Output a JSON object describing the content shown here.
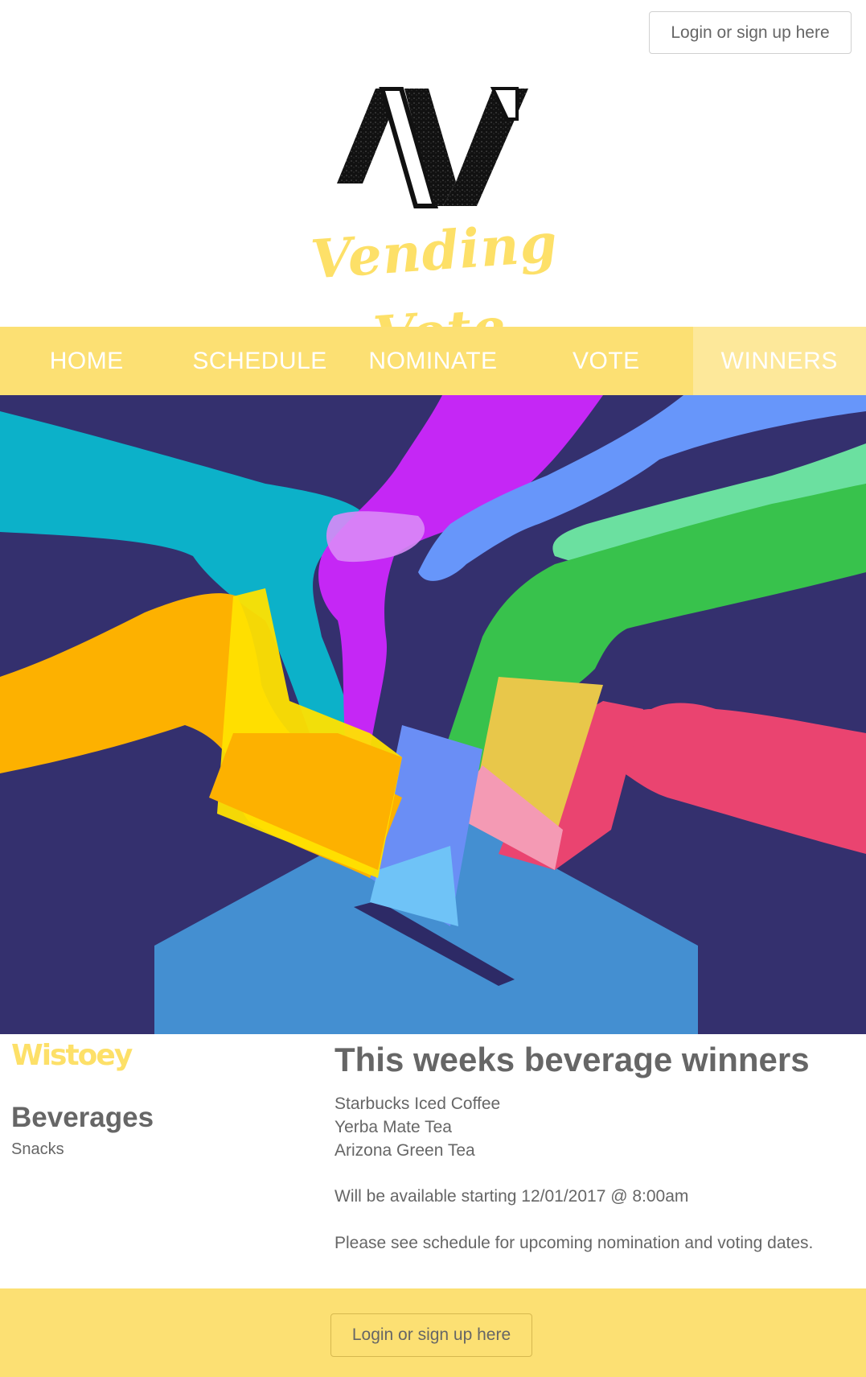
{
  "header": {
    "login_label": "Login or sign up here",
    "logo_text": "Vending Vote"
  },
  "nav": {
    "items": [
      {
        "label": "HOME"
      },
      {
        "label": "SCHEDULE"
      },
      {
        "label": "NOMINATE"
      },
      {
        "label": "VOTE"
      },
      {
        "label": "WINNERS"
      }
    ],
    "active": "WINNERS"
  },
  "sidebar": {
    "title": "Wistoey",
    "links": [
      {
        "label": "Beverages"
      },
      {
        "label": "Snacks"
      }
    ]
  },
  "main": {
    "title": "This weeks beverage winners",
    "winners": [
      "Starbucks Iced Coffee",
      "Yerba Mate Tea",
      "Arizona Green Tea"
    ],
    "availability": "Will be available starting 12/01/2017 @ 8:00am",
    "note": "Please see schedule for upcoming nomination and voting dates."
  },
  "footer": {
    "login_label": "Login or sign up here"
  },
  "colors": {
    "accent": "#fce073",
    "accent_light": "#fde89a",
    "hero_bg": "#34306e",
    "text": "#666666"
  }
}
